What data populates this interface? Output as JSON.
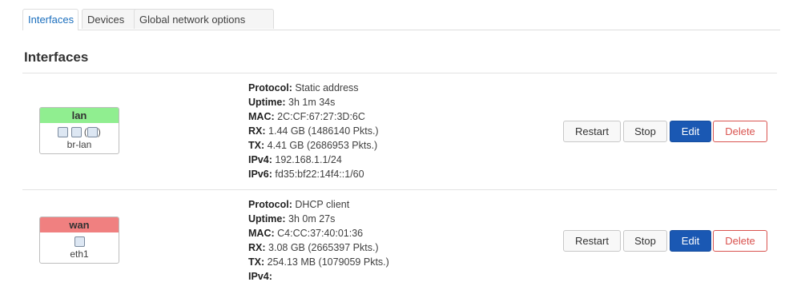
{
  "tabs": [
    {
      "label": "Interfaces",
      "active": true
    },
    {
      "label": "Devices",
      "active": false
    },
    {
      "label": "Global network options",
      "active": false
    }
  ],
  "section_title": "Interfaces",
  "interfaces": [
    {
      "name": "lan",
      "color": "#90ee90",
      "icons_text": "(    )",
      "device": "br-lan",
      "fields": [
        {
          "label": "Protocol:",
          "value": "Static address"
        },
        {
          "label": "Uptime:",
          "value": "3h 1m 34s"
        },
        {
          "label": "MAC:",
          "value": "2C:CF:67:27:3D:6C"
        },
        {
          "label": "RX:",
          "value": "1.44 GB (1486140 Pkts.)"
        },
        {
          "label": "TX:",
          "value": "4.41 GB (2686953 Pkts.)"
        },
        {
          "label": "IPv4:",
          "value": "192.168.1.1/24"
        },
        {
          "label": "IPv6:",
          "value": "fd35:bf22:14f4::1/60"
        }
      ]
    },
    {
      "name": "wan",
      "color": "#f08080",
      "icons_text": "",
      "device": "eth1",
      "fields": [
        {
          "label": "Protocol:",
          "value": "DHCP client"
        },
        {
          "label": "Uptime:",
          "value": "3h 0m 27s"
        },
        {
          "label": "MAC:",
          "value": "C4:CC:37:40:01:36"
        },
        {
          "label": "RX:",
          "value": "3.08 GB (2665397 Pkts.)"
        },
        {
          "label": "TX:",
          "value": "254.13 MB (1079059 Pkts.)"
        },
        {
          "label": "IPv4:",
          "value": ""
        }
      ]
    }
  ],
  "buttons": {
    "restart": "Restart",
    "stop": "Stop",
    "edit": "Edit",
    "delete": "Delete"
  }
}
